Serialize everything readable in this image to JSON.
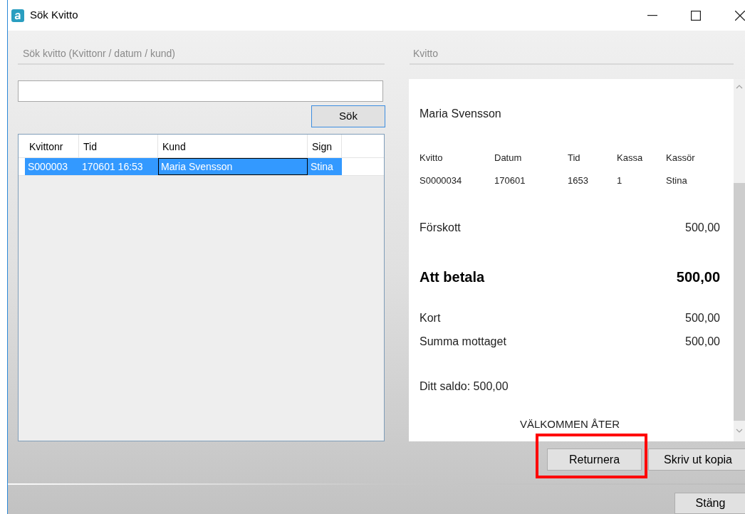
{
  "window": {
    "title": "Sök Kvitto"
  },
  "search": {
    "section_title": "Sök kvitto (Kvittonr / datum / kund)",
    "button": "Sök"
  },
  "results_table": {
    "columns": [
      "Kvittonr",
      "Tid",
      "Kund",
      "Sign"
    ],
    "rows": [
      {
        "selected": true,
        "cells": [
          {
            "text": "S000003",
            "focused": false
          },
          {
            "text": "170601 16:53",
            "focused": false
          },
          {
            "text": "Maria Svensson",
            "focused": true
          },
          {
            "text": "Stina",
            "focused": false
          }
        ]
      }
    ]
  },
  "receipt": {
    "section_title": "Kvitto",
    "customer": "Maria Svensson",
    "info_headers": [
      "Kvitto",
      "Datum",
      "Tid",
      "Kassa",
      "Kassör"
    ],
    "info_values": [
      "S0000034",
      "170601",
      "1653",
      "1",
      "Stina"
    ],
    "line_groups": [
      [
        {
          "kind": "normal",
          "label": "Förskott",
          "amount": "500,00"
        }
      ],
      [
        {
          "kind": "total",
          "label": "Att betala",
          "amount": "500,00"
        }
      ],
      [
        {
          "kind": "normal",
          "label": "Kort",
          "amount": "500,00"
        },
        {
          "kind": "normal",
          "label": "Summa mottaget",
          "amount": "500,00"
        }
      ]
    ],
    "balance": "Ditt saldo: 500,00",
    "footer": "VÄLKOMMEN ÅTER"
  },
  "actions": [
    {
      "label": "Returnera",
      "highlighted": true
    },
    {
      "label": "Skriv ut kopia",
      "highlighted": false
    }
  ],
  "close_button": "Stäng"
}
